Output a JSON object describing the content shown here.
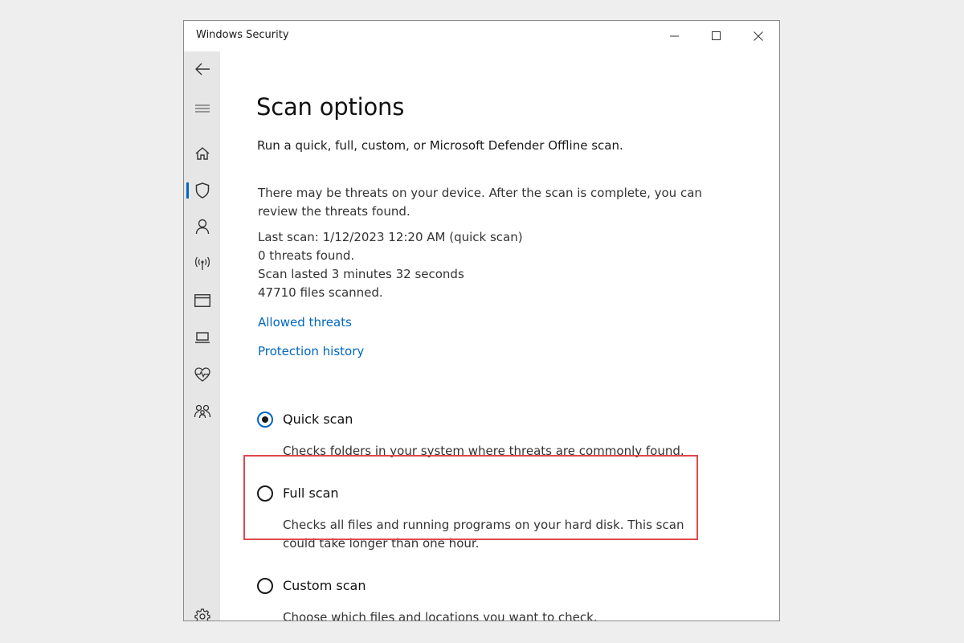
{
  "window": {
    "title": "Windows Security"
  },
  "titlebar_buttons": [
    "minimize-icon",
    "maximize-icon",
    "close-icon"
  ],
  "sidebar": {
    "items": [
      {
        "icon": "back-arrow-icon"
      },
      {
        "icon": "hamburger-menu-icon"
      },
      {
        "icon": "home-icon"
      },
      {
        "icon": "shield-icon",
        "active": true
      },
      {
        "icon": "person-icon"
      },
      {
        "icon": "wireless-antenna-icon"
      },
      {
        "icon": "app-browser-window-icon"
      },
      {
        "icon": "laptop-icon"
      },
      {
        "icon": "heart-pulse-icon"
      },
      {
        "icon": "family-icon"
      },
      {
        "icon": "gear-icon"
      }
    ]
  },
  "page": {
    "title": "Scan options",
    "subtitle": "Run a quick, full, custom, or Microsoft Defender Offline scan.",
    "threat_notice": [
      "There may be threats on your device. After the scan is complete, you can",
      "review the threats found."
    ],
    "last_scan": [
      "Last scan: 1/12/2023 12:20 AM (quick scan)",
      "0 threats found.",
      "Scan lasted 3 minutes 32 seconds",
      "47710 files scanned."
    ],
    "links": {
      "allowed_threats": "Allowed threats",
      "protection_history": "Protection history"
    }
  },
  "scan_options": [
    {
      "label": "Quick scan",
      "selected": true,
      "description": [
        "Checks folders in your system where threats are commonly found."
      ]
    },
    {
      "label": "Full scan",
      "selected": false,
      "highlighted": true,
      "description": [
        "Checks all files and running programs on your hard disk. This scan",
        "could take longer than one hour."
      ]
    },
    {
      "label": "Custom scan",
      "selected": false,
      "description": [
        "Choose which files and locations you want to check."
      ]
    }
  ],
  "colors": {
    "accent": "#0067c0",
    "highlight": "#e0484e",
    "sidebar_bg": "#e6e6e6",
    "page_bg": "#eeeeee"
  }
}
